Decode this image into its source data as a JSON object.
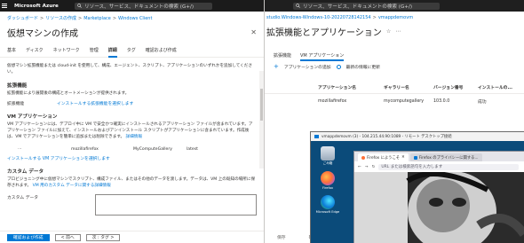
{
  "left": {
    "topbar": {
      "brand": "Microsoft Azure",
      "search_placeholder": "リソース、サービス、ドキュメントの検索 (G+/)"
    },
    "breadcrumb": [
      "ダッシュボード",
      "リソースの作成",
      "Marketplace",
      "Windows Client"
    ],
    "title": "仮想マシンの作成",
    "tabs": [
      "基本",
      "ディスク",
      "ネットワーク",
      "管理",
      "詳細",
      "タグ",
      "確認および作成"
    ],
    "active_tab_index": 4,
    "intro": "仮想マシン拡張機能または cloud-init を使用して、構成、エージェント、スクリプト、アプリケーションのいずれかを追加してください。",
    "extensions": {
      "heading": "拡張機能",
      "desc": "拡張機能により展開後の構成とオートメーションが提供されます。",
      "label": "拡張機能",
      "link": "インストールする拡張機能を選択します"
    },
    "vm_apps": {
      "heading": "VM アプリケーション",
      "desc": "VM アプリケーションには、デプロイ中に VM で安全かつ確実にインストールされるアプリケーション ファイルが含まれています。アプリケーション ファイルに加えて、インストールおよびアンインストール スクリプトがアプリケーションに含まれています。作成後は、VM でアプリケーションを簡単に追加または削除できます。",
      "desc_link": "詳細情報",
      "row": [
        "mozillafirefox",
        "MyComputeGallery",
        "latest"
      ],
      "add_link": "インストールする VM アプリケーションを選択します"
    },
    "custom_data": {
      "heading": "カスタム データ",
      "desc": "プロビジョニング中に仮想マシンでスクリプト、構成ファイル、またはその他のデータを渡します。データは、VM 上の既知の場所に保存されます。",
      "desc_link": "VM 用のカスタム データに関する詳細情報",
      "label": "カスタム データ"
    },
    "footer": {
      "primary": "確認および作成",
      "prev": "< 前へ",
      "next": "次 : タグ >"
    }
  },
  "right": {
    "topbar": {
      "search_placeholder": "リソース、サービス、ドキュメントの検索 (G+/)"
    },
    "breadcrumb": [
      "studio.Windows-Windows-10-20220728142154",
      "vmappdemovm"
    ],
    "title": "拡張機能とアプリケーション",
    "tabs": [
      "拡張機能",
      "VM アプリケーション"
    ],
    "active_tab_index": 1,
    "tools": {
      "add": "アプリケーションの追加",
      "update": "最新の情報に更新"
    },
    "table": {
      "headers": [
        "アプリケーション名",
        "ギャラリー名",
        "バージョン番号",
        "インストールの..."
      ],
      "rows": [
        [
          "mozillafirefox",
          "mycomputegallery",
          "103.0.0",
          "成功"
        ]
      ]
    },
    "footer": [
      "保存",
      "破棄"
    ]
  },
  "rdp": {
    "title": "vmappdemovm (3) - 104.215.44.90:1089 - リモート デスクトップ接続",
    "desktop_icons": [
      "ごみ箱",
      "Firefox",
      "Microsoft Edge"
    ],
    "firefox": {
      "tabs": [
        "Firefox にようこそ",
        "Firefox のプライバシーに関する..."
      ],
      "url_placeholder": "URL または検索語句を入力します"
    }
  }
}
